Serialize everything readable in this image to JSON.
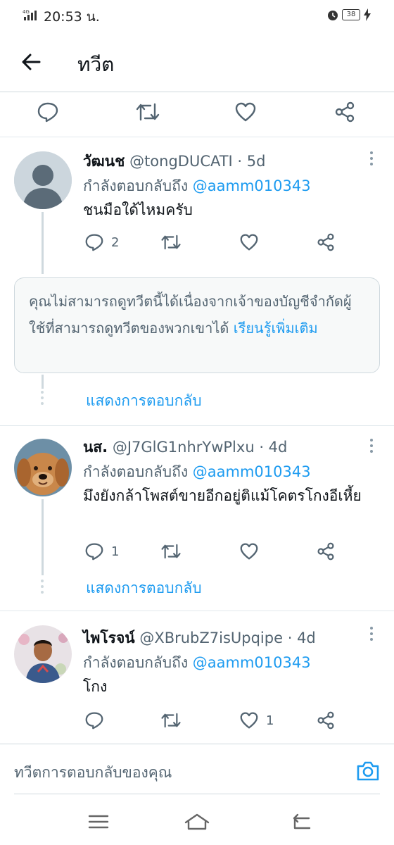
{
  "status_bar": {
    "network": "4G",
    "time": "20:53 น.",
    "battery": "38"
  },
  "header": {
    "title": "ทวีต"
  },
  "replies": [
    {
      "name": "วัฒนช",
      "handle": "@tongDUCATI",
      "age": "5d",
      "replying_prefix": "กำลังตอบกลับถึง",
      "mention": "@aamm010343",
      "text": "ชนมือใด้ไหมครับ",
      "reply_count": "2",
      "retweet_count": "",
      "like_count": ""
    },
    {
      "name": "นส.",
      "handle": "@J7GlG1nhrYwPlxu",
      "age": "4d",
      "replying_prefix": "กำลังตอบกลับถึง",
      "mention": "@aamm010343",
      "text": "มึงยังกล้าโพสต์ขายอีกอยู่ติแม้โคตรโกงอีเหี้ย",
      "reply_count": "1",
      "retweet_count": "",
      "like_count": ""
    },
    {
      "name": "ไพโรจน์",
      "handle": "@XBrubZ7isUpqipe",
      "age": "4d",
      "replying_prefix": "กำลังตอบกลับถึง",
      "mention": "@aamm010343",
      "text": "โกง",
      "reply_count": "",
      "retweet_count": "",
      "like_count": "1"
    }
  ],
  "restricted_notice": {
    "text": "คุณไม่สามารถดูทวีตนี้ได้เนื่องจากเจ้าของบัญชีจำกัดผู้ใช้ที่สามารถดูทวีตของพวกเขาได้",
    "link": "เรียนรู้เพิ่มเติม"
  },
  "show_replies_label": "แสดงการตอบกลับ",
  "compose": {
    "placeholder": "ทวีตการตอบกลับของคุณ"
  },
  "meta_separator": " · ",
  "colors": {
    "accent": "#1d9bf0",
    "text": "#0f1419",
    "muted": "#536471",
    "divider": "#cfd9de"
  },
  "icons": [
    "back-arrow-icon",
    "reply-icon",
    "retweet-icon",
    "like-icon",
    "share-icon",
    "more-icon",
    "camera-icon",
    "menu-icon",
    "home-icon",
    "back-nav-icon"
  ]
}
